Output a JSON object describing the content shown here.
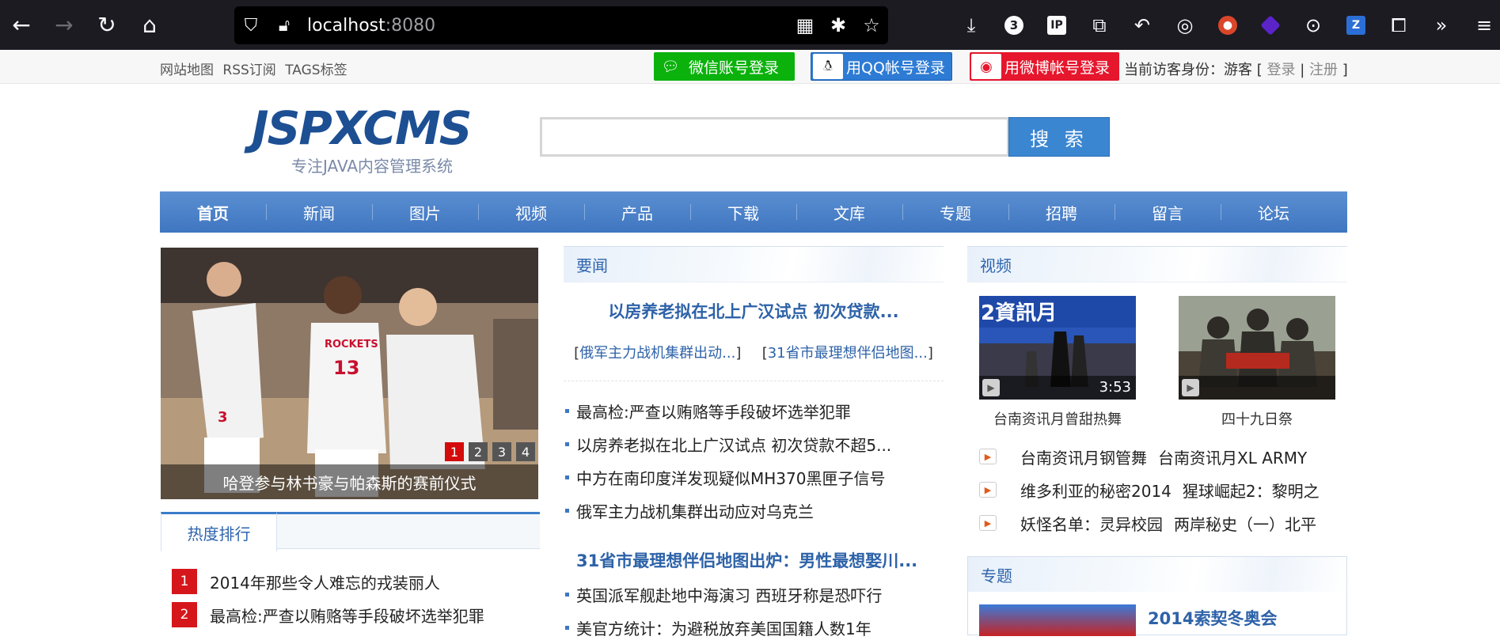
{
  "browser": {
    "url_host": "localhost",
    "url_port": ":8080",
    "ext_badge": "3"
  },
  "topbar": {
    "links": [
      "网站地图",
      "RSS订阅",
      "TAGS标签"
    ],
    "wechat_login": "微信账号登录",
    "qq_login": "用QQ帐号登录",
    "weibo_login": "用微博帐号登录",
    "visitor_label": "当前访客身份：游客 [",
    "login": "登录",
    "sep": "|",
    "register": "注册",
    "close_bracket": "]"
  },
  "logo": {
    "main": "JSPXCMS",
    "sub": "专注JAVA内容管理系统"
  },
  "search": {
    "button": "搜 索",
    "placeholder": ""
  },
  "nav": [
    "首页",
    "新闻",
    "图片",
    "视频",
    "产品",
    "下载",
    "文库",
    "专题",
    "招聘",
    "留言",
    "论坛"
  ],
  "slider": {
    "caption": "哈登参与林书豪与帕森斯的赛前仪式",
    "pages": [
      "1",
      "2",
      "3",
      "4"
    ],
    "active": 1,
    "jersey_text": "ROCKETS",
    "jersey_numbers": [
      "13",
      "3"
    ]
  },
  "ranking": {
    "tab": "热度排行",
    "items": [
      {
        "num": "1",
        "title": "2014年那些令人难忘的戎装丽人"
      },
      {
        "num": "2",
        "title": "最高检:严查以贿赂等手段破坏选举犯罪"
      }
    ]
  },
  "news": {
    "header": "要闻",
    "headline": "以房养老拟在北上广汉试点 初次贷款...",
    "sub1_open": "[",
    "sub1": "俄军主力战机集群出动...",
    "sub1_close": "]",
    "sub2_open": "[",
    "sub2": "31省市最理想伴侣地图...",
    "sub2_close": "]",
    "list1": [
      "最高检:严查以贿赂等手段破坏选举犯罪",
      "以房养老拟在北上广汉试点 初次贷款不超5...",
      "中方在南印度洋发现疑似MH370黑匣子信号",
      "俄军主力战机集群出动应对乌克兰"
    ],
    "bold_headline": "31省市最理想伴侣地图出炉：男性最想娶川...",
    "list2": [
      "英国派军舰赴地中海演习 西班牙称是恐吓行",
      "美官方统计：为避税放弃美国国籍人数1年"
    ]
  },
  "video": {
    "header": "视频",
    "thumbs": [
      {
        "title": "台南资讯月曾甜热舞",
        "duration": "3:53",
        "overlay": "2資訊月"
      },
      {
        "title": "四十九日祭",
        "duration": "",
        "overlay": ""
      }
    ],
    "list": [
      [
        "台南资讯月钢管舞",
        "台南资讯月XL ARMY"
      ],
      [
        "维多利亚的秘密2014",
        "猩球崛起2：黎明之"
      ],
      [
        "妖怪名单：灵异校园",
        "两岸秘史（一）北平"
      ]
    ]
  },
  "special": {
    "header": "专题",
    "title": "2014索契冬奥会"
  }
}
